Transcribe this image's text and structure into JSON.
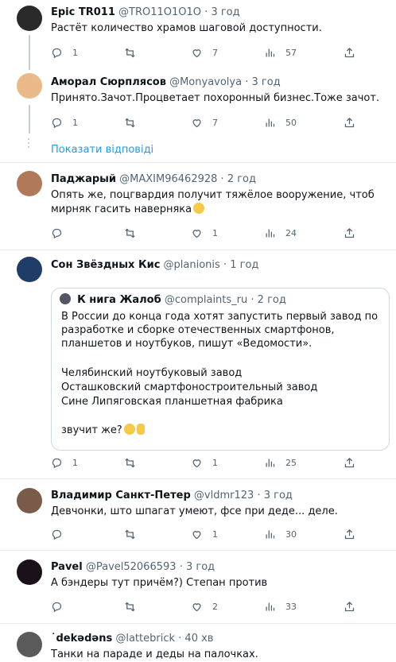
{
  "tweets": [
    {
      "name": "Epic TR011",
      "handle": "@TRO11O1O1O",
      "time": "3 год",
      "text": "Растёт количество храмов шаговой доступности.",
      "replies": "1",
      "retweets": "",
      "likes": "7",
      "views": "57"
    },
    {
      "name": "Аморал Сюрплясов",
      "handle": "@Monyavolya",
      "time": "3 год",
      "text": "Принято.Зачот.Процветает похоронный бизнес.Тоже зачот.",
      "replies": "1",
      "retweets": "",
      "likes": "7",
      "views": "50"
    },
    {
      "name": "Паджарый",
      "handle": "@MAXIM96462928",
      "time": "2 год",
      "text": "Опять же, поцгвардия получит тяжёлое вооружение, чтоб мирняк гасить наверняка",
      "replies": "",
      "retweets": "",
      "likes": "1",
      "views": "24"
    },
    {
      "name": "Сон Звёздных Кис",
      "handle": "@planionis",
      "time": "1 год",
      "text": "",
      "replies": "1",
      "retweets": "",
      "likes": "1",
      "views": "25"
    },
    {
      "name": "Владимир Санкт-Петер",
      "handle": "@vldmr123",
      "time": "3 год",
      "text": "Девчонки,  што шпагат умеют, фсе при деде... деле.",
      "replies": "",
      "retweets": "",
      "likes": "1",
      "views": "30"
    },
    {
      "name": "Pavel",
      "handle": "@Pavel52066593",
      "time": "3 год",
      "text": "А бэндеры тут причём?) Степан против",
      "replies": "",
      "retweets": "",
      "likes": "2",
      "views": "33"
    },
    {
      "name": "˙dekədəns",
      "handle": "@lattebrick",
      "time": "40 хв",
      "text": "Танки на параде и деды на палочках.",
      "replies": "",
      "retweets": "",
      "likes": "",
      "views": ""
    }
  ],
  "show_replies": "Показати відповіді",
  "quote": {
    "name": "К нига Жалоб",
    "handle": "@complaints_ru",
    "time": "2 год",
    "p1": "В России до конца года хотят запустить первый завод по разработке и сборке отечественных смартфонов, планшетов и ноутбуков, пишут «Ведомости».",
    "l1": "Челябинский ноутбуковый завод",
    "l2": "Осташковский смартфоностроительный завод",
    "l3": "Сине Липяговская планшетная фабрика",
    "p3": "звучит же?"
  },
  "sep": "·",
  "icons": [
    "reply-icon",
    "retweet-icon",
    "like-icon",
    "views-icon",
    "share-icon"
  ],
  "colors": {
    "link": "#1d9bf0",
    "muted": "#536471",
    "divider": "#e6ecf0"
  }
}
